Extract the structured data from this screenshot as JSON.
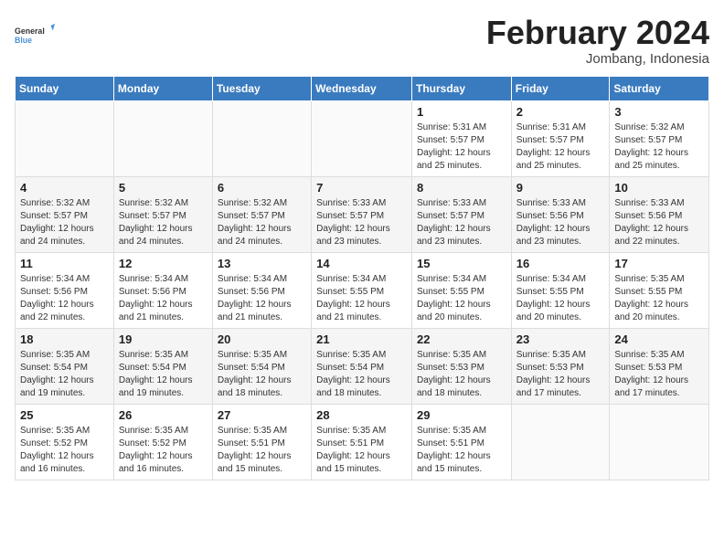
{
  "header": {
    "logo_general": "General",
    "logo_blue": "Blue",
    "month_title": "February 2024",
    "location": "Jombang, Indonesia"
  },
  "days_of_week": [
    "Sunday",
    "Monday",
    "Tuesday",
    "Wednesday",
    "Thursday",
    "Friday",
    "Saturday"
  ],
  "weeks": [
    [
      {
        "day": "",
        "info": ""
      },
      {
        "day": "",
        "info": ""
      },
      {
        "day": "",
        "info": ""
      },
      {
        "day": "",
        "info": ""
      },
      {
        "day": "1",
        "info": "Sunrise: 5:31 AM\nSunset: 5:57 PM\nDaylight: 12 hours and 25 minutes."
      },
      {
        "day": "2",
        "info": "Sunrise: 5:31 AM\nSunset: 5:57 PM\nDaylight: 12 hours and 25 minutes."
      },
      {
        "day": "3",
        "info": "Sunrise: 5:32 AM\nSunset: 5:57 PM\nDaylight: 12 hours and 25 minutes."
      }
    ],
    [
      {
        "day": "4",
        "info": "Sunrise: 5:32 AM\nSunset: 5:57 PM\nDaylight: 12 hours and 24 minutes."
      },
      {
        "day": "5",
        "info": "Sunrise: 5:32 AM\nSunset: 5:57 PM\nDaylight: 12 hours and 24 minutes."
      },
      {
        "day": "6",
        "info": "Sunrise: 5:32 AM\nSunset: 5:57 PM\nDaylight: 12 hours and 24 minutes."
      },
      {
        "day": "7",
        "info": "Sunrise: 5:33 AM\nSunset: 5:57 PM\nDaylight: 12 hours and 23 minutes."
      },
      {
        "day": "8",
        "info": "Sunrise: 5:33 AM\nSunset: 5:57 PM\nDaylight: 12 hours and 23 minutes."
      },
      {
        "day": "9",
        "info": "Sunrise: 5:33 AM\nSunset: 5:56 PM\nDaylight: 12 hours and 23 minutes."
      },
      {
        "day": "10",
        "info": "Sunrise: 5:33 AM\nSunset: 5:56 PM\nDaylight: 12 hours and 22 minutes."
      }
    ],
    [
      {
        "day": "11",
        "info": "Sunrise: 5:34 AM\nSunset: 5:56 PM\nDaylight: 12 hours and 22 minutes."
      },
      {
        "day": "12",
        "info": "Sunrise: 5:34 AM\nSunset: 5:56 PM\nDaylight: 12 hours and 21 minutes."
      },
      {
        "day": "13",
        "info": "Sunrise: 5:34 AM\nSunset: 5:56 PM\nDaylight: 12 hours and 21 minutes."
      },
      {
        "day": "14",
        "info": "Sunrise: 5:34 AM\nSunset: 5:55 PM\nDaylight: 12 hours and 21 minutes."
      },
      {
        "day": "15",
        "info": "Sunrise: 5:34 AM\nSunset: 5:55 PM\nDaylight: 12 hours and 20 minutes."
      },
      {
        "day": "16",
        "info": "Sunrise: 5:34 AM\nSunset: 5:55 PM\nDaylight: 12 hours and 20 minutes."
      },
      {
        "day": "17",
        "info": "Sunrise: 5:35 AM\nSunset: 5:55 PM\nDaylight: 12 hours and 20 minutes."
      }
    ],
    [
      {
        "day": "18",
        "info": "Sunrise: 5:35 AM\nSunset: 5:54 PM\nDaylight: 12 hours and 19 minutes."
      },
      {
        "day": "19",
        "info": "Sunrise: 5:35 AM\nSunset: 5:54 PM\nDaylight: 12 hours and 19 minutes."
      },
      {
        "day": "20",
        "info": "Sunrise: 5:35 AM\nSunset: 5:54 PM\nDaylight: 12 hours and 18 minutes."
      },
      {
        "day": "21",
        "info": "Sunrise: 5:35 AM\nSunset: 5:54 PM\nDaylight: 12 hours and 18 minutes."
      },
      {
        "day": "22",
        "info": "Sunrise: 5:35 AM\nSunset: 5:53 PM\nDaylight: 12 hours and 18 minutes."
      },
      {
        "day": "23",
        "info": "Sunrise: 5:35 AM\nSunset: 5:53 PM\nDaylight: 12 hours and 17 minutes."
      },
      {
        "day": "24",
        "info": "Sunrise: 5:35 AM\nSunset: 5:53 PM\nDaylight: 12 hours and 17 minutes."
      }
    ],
    [
      {
        "day": "25",
        "info": "Sunrise: 5:35 AM\nSunset: 5:52 PM\nDaylight: 12 hours and 16 minutes."
      },
      {
        "day": "26",
        "info": "Sunrise: 5:35 AM\nSunset: 5:52 PM\nDaylight: 12 hours and 16 minutes."
      },
      {
        "day": "27",
        "info": "Sunrise: 5:35 AM\nSunset: 5:51 PM\nDaylight: 12 hours and 15 minutes."
      },
      {
        "day": "28",
        "info": "Sunrise: 5:35 AM\nSunset: 5:51 PM\nDaylight: 12 hours and 15 minutes."
      },
      {
        "day": "29",
        "info": "Sunrise: 5:35 AM\nSunset: 5:51 PM\nDaylight: 12 hours and 15 minutes."
      },
      {
        "day": "",
        "info": ""
      },
      {
        "day": "",
        "info": ""
      }
    ]
  ]
}
